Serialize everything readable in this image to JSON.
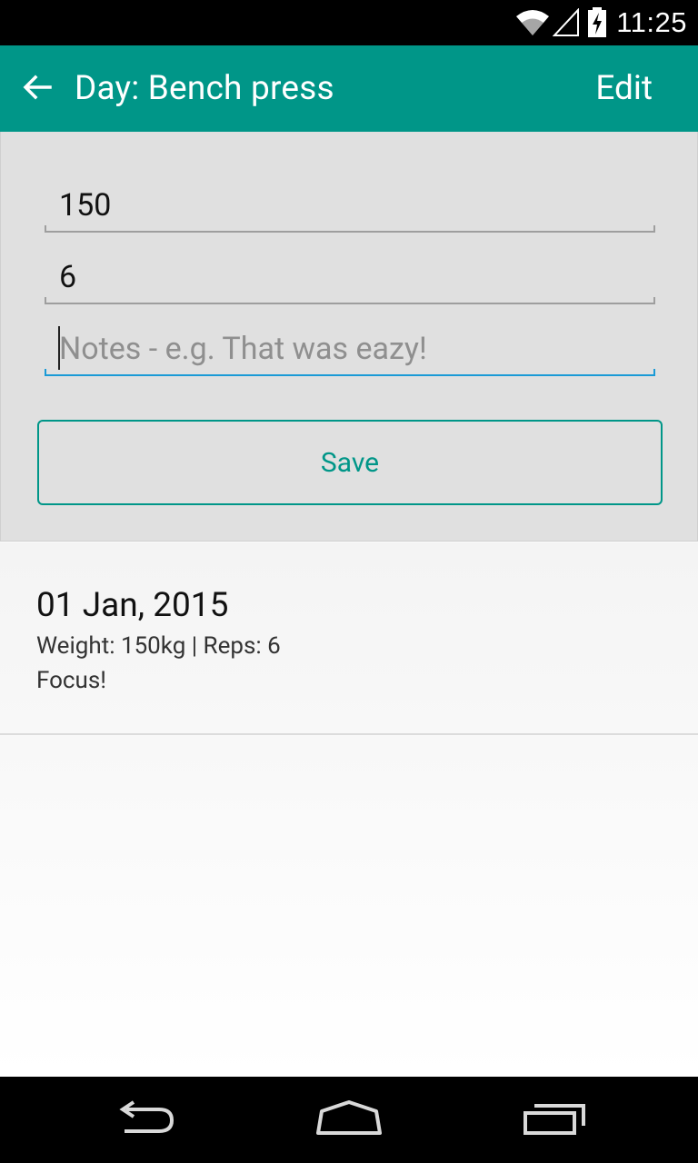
{
  "status_bar": {
    "time": "11:25",
    "icons": [
      "wifi-icon",
      "cell-signal-icon",
      "battery-charging-icon"
    ]
  },
  "app_bar": {
    "back_icon": "arrow-back-icon",
    "title": "Day: Bench press",
    "edit_label": "Edit",
    "color": "#009688"
  },
  "form": {
    "weight_value": "150",
    "reps_value": "6",
    "notes_value": "",
    "notes_placeholder": "Notes - e.g. That was eazy!",
    "save_label": "Save",
    "focus_color": "#1a9ad6"
  },
  "entries": [
    {
      "date": "01 Jan, 2015",
      "details": "Weight: 150kg | Reps: 6",
      "notes": "Focus!"
    }
  ],
  "nav_bar": {
    "icons": [
      "nav-back-icon",
      "nav-home-icon",
      "nav-recents-icon"
    ]
  }
}
